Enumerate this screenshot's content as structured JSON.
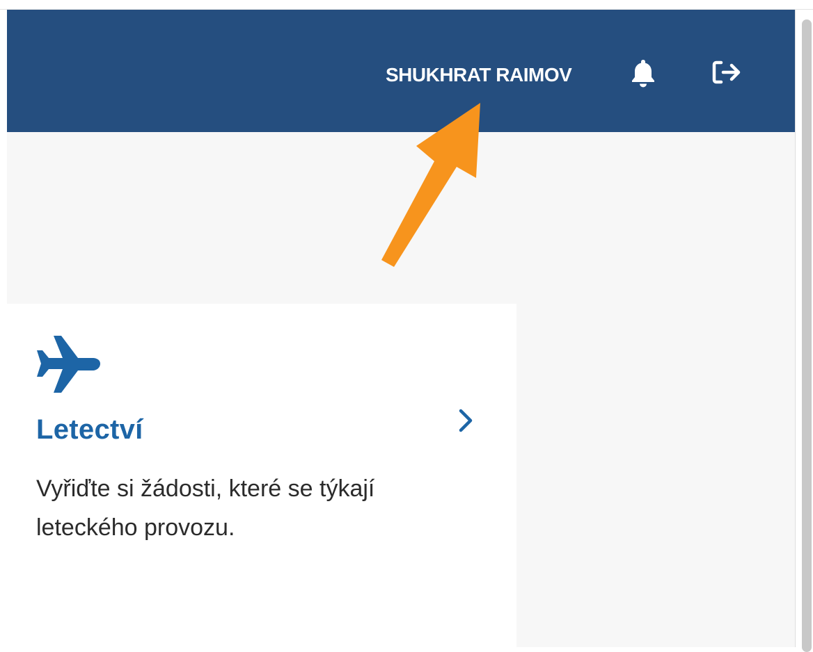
{
  "header": {
    "user_name": "SHUKHRAT RAIMOV",
    "bell_icon": "bell-icon",
    "logout_icon": "logout-icon",
    "background_color": "#254e7f"
  },
  "card": {
    "icon": "airplane-icon",
    "title": "Letectví",
    "description": "Vyřiďte si žádosti, které se týkají leteckého provozu.",
    "chevron_icon": "chevron-right-icon",
    "title_color": "#1d65a6"
  },
  "annotation": {
    "arrow_color": "#f7941d",
    "points_to": "user-name"
  }
}
